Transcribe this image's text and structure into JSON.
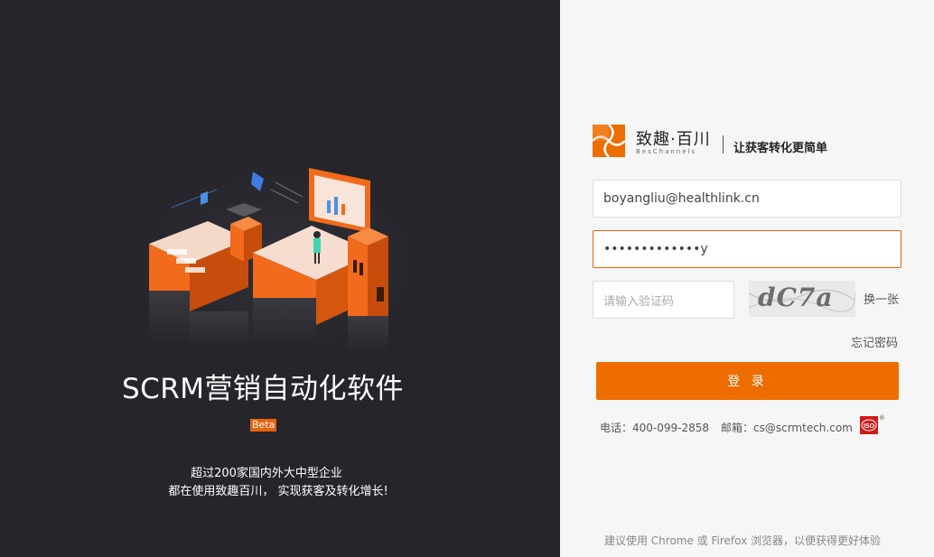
{
  "left": {
    "title": "SCRM营销自动化软件",
    "beta": "Beta",
    "desc_line1": "超过200家国内外大中型企业",
    "desc_line2": "都在使用致趣百川， 实现获客及转化增长!"
  },
  "brand": {
    "name": "致趣·百川",
    "sub": "BesChannels",
    "slogan": "让获客转化更简单"
  },
  "form": {
    "username_value": "boyangliu@healthlink.cn",
    "password_value": "•••••••••••••y",
    "captcha_placeholder": "请输入验证码",
    "captcha_image_text": "dC7a",
    "swap_label": "换一张",
    "forgot_label": "忘记密码",
    "login_label": "登 录"
  },
  "contact": {
    "phone": "电话：400-099-2858",
    "email": "邮箱：cs@scrmtech.com",
    "reg_mark": "®"
  },
  "tip": "建议使用 Chrome 或 Firefox 浏览器，以便获得更好体验",
  "colors": {
    "accent": "#ed6d00",
    "left_bg": "#25252b",
    "right_bg": "#f6f6f6"
  },
  "icons": [
    "brand-logo-icon",
    "iso-badge-icon"
  ]
}
